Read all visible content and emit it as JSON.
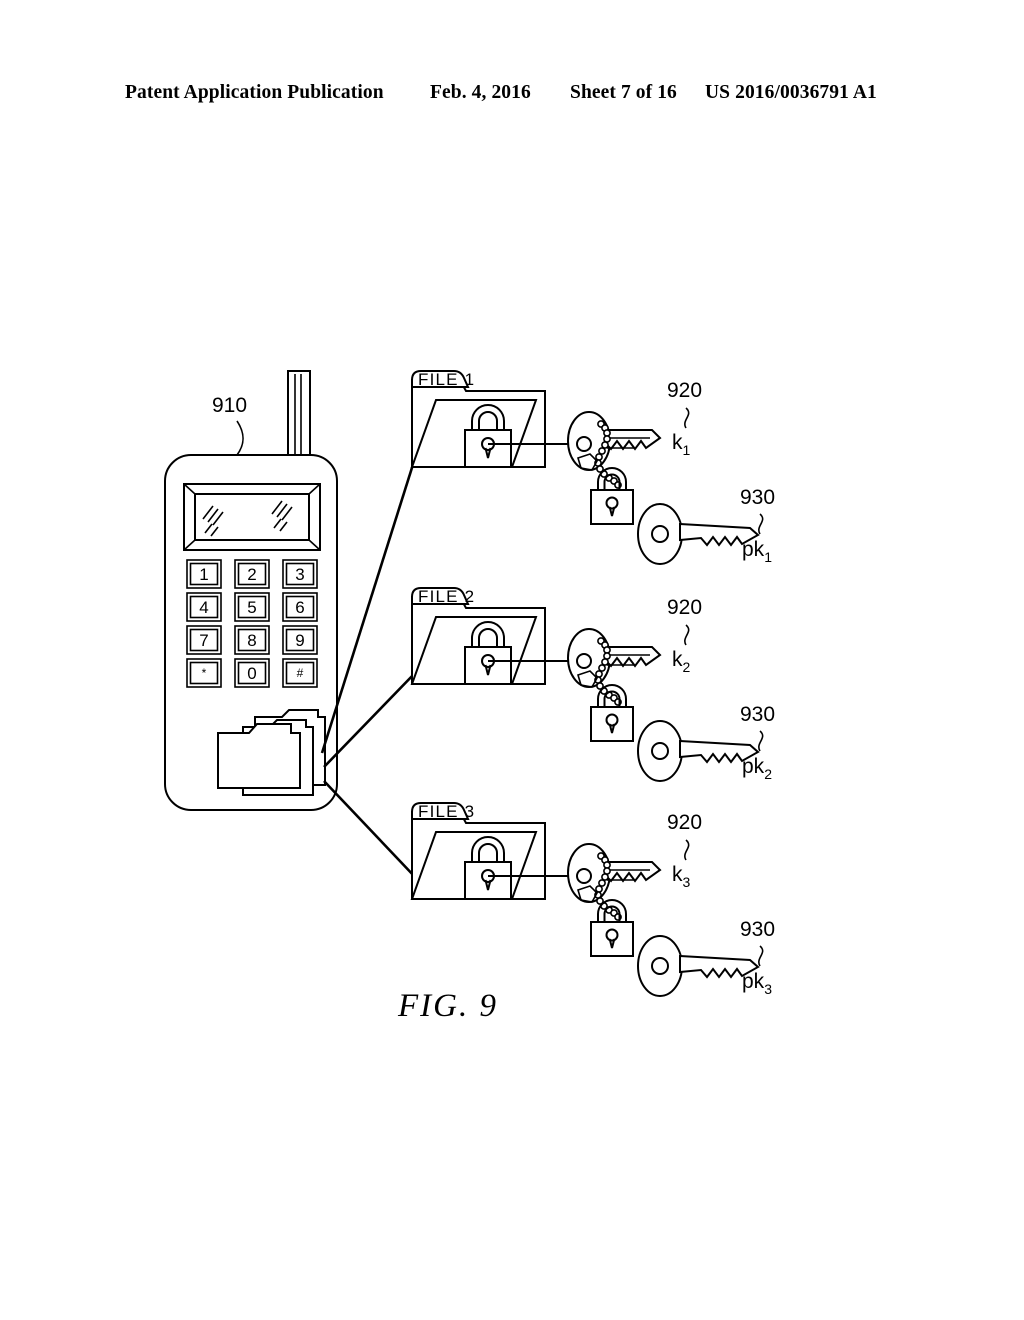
{
  "header": {
    "publication": "Patent Application Publication",
    "date": "Feb. 4, 2016",
    "sheet": "Sheet 7 of 16",
    "patent_number": "US 2016/0036791 A1"
  },
  "figure": {
    "caption": "FIG. 9",
    "device": {
      "ref_label": "910",
      "keypad": [
        [
          "1",
          "2",
          "3"
        ],
        [
          "4",
          "5",
          "6"
        ],
        [
          "7",
          "8",
          "9"
        ],
        [
          "*",
          "0",
          "#"
        ]
      ]
    },
    "groups": [
      {
        "folder_label": "FILE 1",
        "key_ref": "920",
        "key_name": "k",
        "key_sub": "1",
        "public_key_ref": "930",
        "public_key_name": "pk",
        "public_key_sub": "1"
      },
      {
        "folder_label": "FILE 2",
        "key_ref": "920",
        "key_name": "k",
        "key_sub": "2",
        "public_key_ref": "930",
        "public_key_name": "pk",
        "public_key_sub": "2"
      },
      {
        "folder_label": "FILE 3",
        "key_ref": "920",
        "key_name": "k",
        "key_sub": "3",
        "public_key_ref": "930",
        "public_key_name": "pk",
        "public_key_sub": "3"
      }
    ]
  },
  "colors": {
    "ink": "#000000",
    "paper": "#ffffff"
  }
}
